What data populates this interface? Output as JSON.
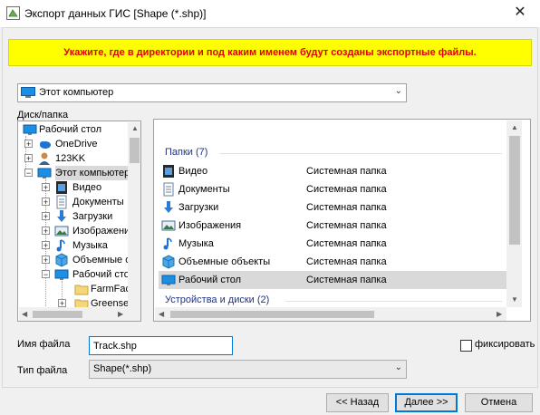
{
  "window": {
    "title": "Экспорт данных ГИС [Shape (*.shp)]",
    "close_glyph": "✕"
  },
  "banner": {
    "text": "Укажите, где в директории и под каким именем будут созданы экспортные файлы."
  },
  "location": {
    "value": "Этот компьютер"
  },
  "tree": {
    "label": "Диск/папка",
    "items": [
      {
        "label": "Рабочий стол",
        "icon": "desktop-icon"
      },
      {
        "label": "OneDrive",
        "icon": "cloud-icon"
      },
      {
        "label": "123KK",
        "icon": "user-icon"
      },
      {
        "label": "Этот компьютер",
        "icon": "computer-icon"
      },
      {
        "label": "Видео",
        "icon": "video-folder-icon"
      },
      {
        "label": "Документы",
        "icon": "documents-folder-icon"
      },
      {
        "label": "Загрузки",
        "icon": "downloads-icon"
      },
      {
        "label": "Изображения",
        "icon": "pictures-folder-icon"
      },
      {
        "label": "Музыка",
        "icon": "music-icon"
      },
      {
        "label": "Объемные объекты",
        "icon": "3d-objects-icon"
      },
      {
        "label": "Рабочий стол",
        "icon": "desktop-icon"
      },
      {
        "label": "FarmFactor",
        "icon": "folder-icon"
      },
      {
        "label": "Greensea",
        "icon": "folder-icon"
      }
    ]
  },
  "filelist": {
    "group_folders": "Папки (7)",
    "group_devices": "Устройства и диски (2)",
    "rows": [
      {
        "name": "Видео",
        "type": "Системная папка",
        "icon": "video-folder-icon"
      },
      {
        "name": "Документы",
        "type": "Системная папка",
        "icon": "documents-folder-icon"
      },
      {
        "name": "Загрузки",
        "type": "Системная папка",
        "icon": "downloads-icon"
      },
      {
        "name": "Изображения",
        "type": "Системная папка",
        "icon": "pictures-folder-icon"
      },
      {
        "name": "Музыка",
        "type": "Системная папка",
        "icon": "music-icon"
      },
      {
        "name": "Объемные объекты",
        "type": "Системная папка",
        "icon": "3d-objects-icon"
      },
      {
        "name": "Рабочий стол",
        "type": "Системная папка",
        "icon": "desktop-icon",
        "selected": true
      }
    ]
  },
  "form": {
    "filename_label": "Имя файла",
    "filename_value": "Track.shp",
    "filetype_label": "Тип файла",
    "filetype_value": "Shape(*.shp)",
    "fix_label": "фиксировать"
  },
  "buttons": {
    "back": "<< Назад",
    "next": "Далее >>",
    "cancel": "Отмена"
  },
  "colors": {
    "banner_bg": "#ffff00",
    "banner_text": "#e00000",
    "group_header": "#1e3287",
    "focus": "#0078d7"
  }
}
